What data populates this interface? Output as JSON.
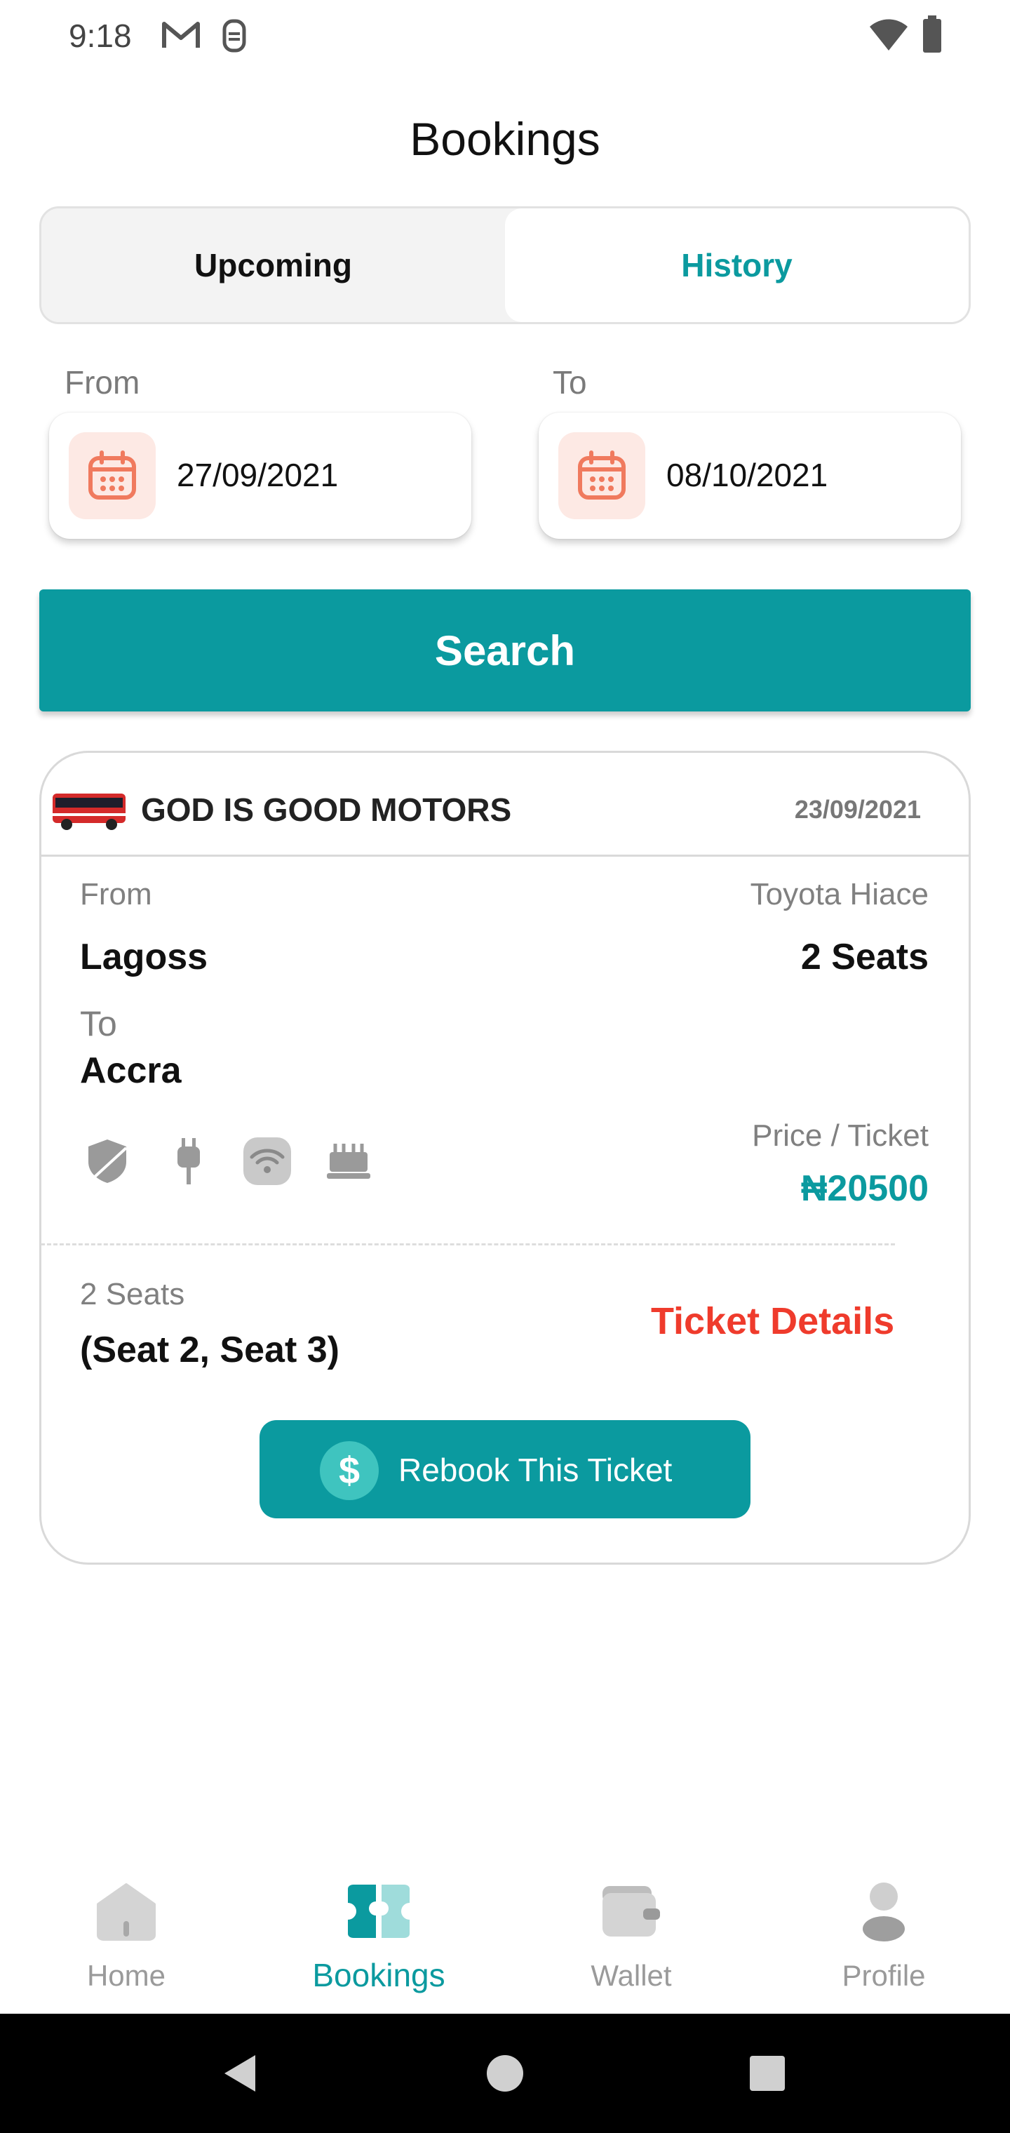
{
  "status_bar": {
    "time": "9:18",
    "icons": [
      "gmail-icon",
      "notification-icon",
      "wifi-icon",
      "battery-icon"
    ]
  },
  "header": {
    "title": "Bookings"
  },
  "tabs": [
    {
      "label": "Upcoming",
      "active": false
    },
    {
      "label": "History",
      "active": true
    }
  ],
  "filters": {
    "from_label": "From",
    "from_date": "27/09/2021",
    "to_label": "To",
    "to_date": "08/10/2021",
    "search_label": "Search"
  },
  "booking": {
    "operator": "GOD IS GOOD MOTORS",
    "date": "23/09/2021",
    "from_label": "From",
    "from": "Lagoss",
    "to_label": "To",
    "to": "Accra",
    "vehicle": "Toyota Hiace",
    "seats_count": "2 Seats",
    "price_label": "Price / Ticket",
    "price": "₦20500",
    "amenities": [
      "shield-icon",
      "charger-plug-icon",
      "wifi-icon",
      "food-icon"
    ],
    "seats_summary": "2 Seats",
    "seat_list": "(Seat 2, Seat 3)",
    "ticket_details_label": "Ticket Details",
    "rebook_label": "Rebook This Ticket"
  },
  "bottom_nav": [
    {
      "label": "Home",
      "icon": "home-icon",
      "active": false
    },
    {
      "label": "Bookings",
      "icon": "tickets-icon",
      "active": true
    },
    {
      "label": "Wallet",
      "icon": "wallet-icon",
      "active": false
    },
    {
      "label": "Profile",
      "icon": "profile-icon",
      "active": false
    }
  ],
  "colors": {
    "accent": "#0b9a9f",
    "danger": "#ef3b2c",
    "calendar": "#f07a5e"
  }
}
